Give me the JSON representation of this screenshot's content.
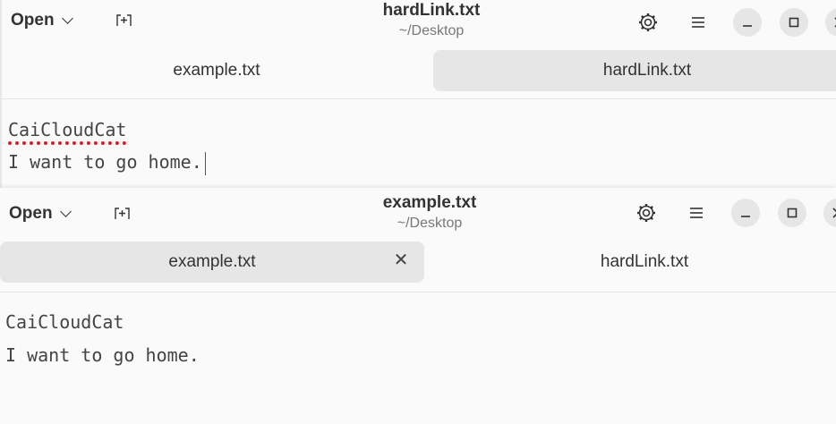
{
  "windows": [
    {
      "open_label": "Open",
      "title": "hardLink.txt",
      "subtitle": "~/Desktop",
      "tabs": [
        {
          "label": "example.txt",
          "active": false
        },
        {
          "label": "hardLink.txt",
          "active": true
        }
      ],
      "lines": [
        "CaiCloudCat",
        "I want to go home."
      ]
    },
    {
      "open_label": "Open",
      "title": "example.txt",
      "subtitle": "~/Desktop",
      "tabs": [
        {
          "label": "example.txt",
          "active": true,
          "close": "✕"
        },
        {
          "label": "hardLink.txt",
          "active": false
        }
      ],
      "lines": [
        "CaiCloudCat",
        "I want to go home."
      ]
    }
  ],
  "icons": {
    "new_tab": "new-tab-icon",
    "settings": "gear-icon",
    "menu": "hamburger-menu-icon",
    "minimize": "minimize-icon",
    "maximize": "maximize-icon",
    "close": "close-icon"
  },
  "colors": {
    "spellcheck": "#e01b24",
    "active_tab": "#e6e6e6",
    "window_bg": "#fafafa"
  }
}
